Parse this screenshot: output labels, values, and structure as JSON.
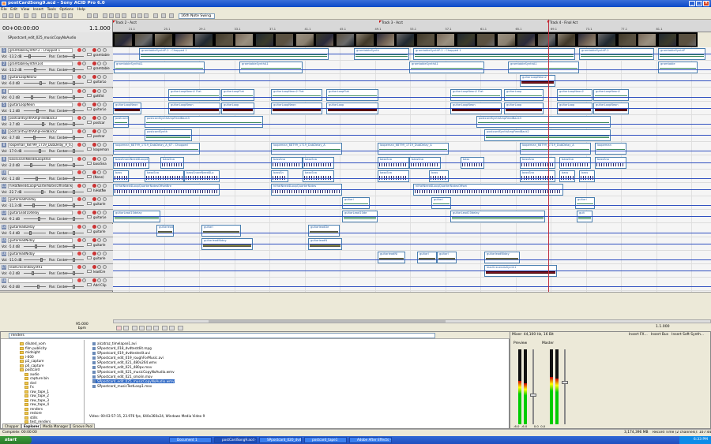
{
  "window": {
    "title": "postCardSong9.acd - Sony ACID Pro 6.0"
  },
  "menu": [
    "File",
    "Edit",
    "View",
    "Insert",
    "Tools",
    "Options",
    "Help"
  ],
  "toolbar": {
    "beat_mode": "16th Note Swing"
  },
  "time": {
    "position": "00+00:00:00",
    "tempo_scale": "1.1.000"
  },
  "markers": [
    {
      "label": "Track 2 - Acct",
      "pos": 0
    },
    {
      "label": "Track 3 - Acct",
      "pos": 0.45
    },
    {
      "label": "Track 4 - Final Act",
      "pos": 0.73
    }
  ],
  "ruler_ticks": [
    "21.1",
    "25.1",
    "29.1",
    "33.1",
    "37.1",
    "41.1",
    "45.1",
    "49.1",
    "53.1",
    "57.1",
    "61.1",
    "65.1",
    "69.1",
    "73.1",
    "77.1",
    "81.1"
  ],
  "video_track": {
    "name": "SPpostcard_edit_025_musicCopyNoAudio"
  },
  "tracks": [
    {
      "name": "gramtableSynthP-2 - Chopped 1",
      "vol": "Vol: -13.2 dB",
      "pan": "Pan: Center",
      "file": "gramtable"
    },
    {
      "name": "gramtableSynthA1x4",
      "vol": "Vol: -13.2 dB",
      "pan": "Pan: Center",
      "file": "gramtable"
    },
    {
      "name": "guitarLoopNeon2",
      "vol": "Vol: -6.0 dB",
      "pan": "Pan: Center",
      "file": "guitarLo"
    },
    {
      "name": "",
      "vol": "Vol: -0.2 dB",
      "pan": "Pan: Center",
      "file": "gattfat"
    },
    {
      "name": "guitarLoopNeon",
      "vol": "Vol: -1.1 dB",
      "pan": "Pan: Center",
      "file": "guitarLo"
    },
    {
      "name": "postcardSynthAmpFeedBack3",
      "vol": "Vol: -3.7 dB",
      "pan": "Pan: Center",
      "file": "postcar"
    },
    {
      "name": "postcardSynthAmpFeedBack2",
      "vol": "Vol: -3.7 dB",
      "pan": "Pan: Center",
      "file": "postcar"
    },
    {
      "name": "loopeman_68799_1719_DubDelay_A_67 - C",
      "vol": "Vol: -17.0 dB",
      "pan": "Pan: Center",
      "file": "loopeman"
    },
    {
      "name": "bassSnareNeed4Loop4fan",
      "vol": "Vol: -2.0 dB",
      "pan": "Pan: Center",
      "file": "bassSna"
    },
    {
      "name": "",
      "vol": "Vol: -1.1 dB",
      "pan": "Pan: Center",
      "file": "(None)"
    },
    {
      "name": "hiHatNeed4LoopPuarterNotesOffsetBrw",
      "vol": "Vol: -22.7 dB",
      "pan": "Pan: Center",
      "file": "hiHatNe"
    },
    {
      "name": "guitarleadhslday",
      "vol": "Vol: -11.3 dB",
      "pan": "Pan: Center",
      "file": "guitarle"
    },
    {
      "name": "guitarLead10delay",
      "vol": "Vol: -9.1 dB",
      "pan": "Pan: Center",
      "file": "guitarLe"
    },
    {
      "name": "guitarleadDelay",
      "vol": "Vol: -5.4 dB",
      "pan": "Pan: Center",
      "file": "guitarle"
    },
    {
      "name": "guitarleadNiday",
      "vol": "Vol: -5.4 dB",
      "pan": "Pan: Center",
      "file": "guitarle"
    },
    {
      "name": "guitarleadNiday",
      "vol": "Vol: -11.0 dB",
      "pan": "Pan: Center",
      "file": "guitarle"
    },
    {
      "name": "leadCrecendoSynth1",
      "vol": "Vol: -0.2 dB",
      "pan": "Pan: Center",
      "file": "leadCre"
    },
    {
      "name": "",
      "vol": "Vol: -6.0 dB",
      "pan": "Pan: Center",
      "file": "Add Clip"
    }
  ],
  "transport": {
    "bpm_value": "95.000",
    "bpm_label": "bpm",
    "position": "1.1.000"
  },
  "explorer": {
    "path": "renders",
    "tree": [
      "diluted_vom",
      "film publicity",
      "midnight",
      "i-600",
      "p2_capture",
      "p0_capture",
      "postcard",
      "audio",
      "capture bin",
      "dvd",
      "Fx",
      "raw_tape_1",
      "raw_tape_2",
      "raw_tape_3",
      "raw_tape_4",
      "renders",
      "restore",
      "stills",
      "test_renders"
    ],
    "files": [
      "alcatraz_timelapse1.avi",
      "SPpostcard_018_dvdtestdiit.mpg",
      "SPpostcard_019_dvdtestedit.avi",
      "SPpostcard_edit_019_roughForMusic.avi",
      "SPpostcard_edit_021_480x264.wmv",
      "SPpostcard_edit_021_480px.mov",
      "SPpostcard_edit_021_musicCopyNoAudio.wmv",
      "SPpostcard_edit_021_smolin.mov",
      "SPpostcard_edit_025_musicCopyNoAudio.wmv",
      "SPpostcard_musicTestLoop1.mov"
    ],
    "status": "Video: 00:03:57:15, 23.976 fps, 640x360x24, Windows Media Video 9",
    "tabs": [
      "Chopper",
      "Explorer",
      "Media Manager",
      "Groove Pool"
    ]
  },
  "mixer": {
    "title": "Mixer: 44,100 Hz, 16 Bit",
    "buttons": [
      "Insert FX...",
      "Insert Bus",
      "Insert Soft Synth..."
    ],
    "preview": "Preview",
    "master": "Master",
    "vals": [
      "-6.0",
      "-6.0",
      "0.0",
      "0.0"
    ]
  },
  "status": {
    "left": "Complete: 00:00:00",
    "mid": "3,174,396 MB",
    "right": "Record Time (2 channels): 107:44:13"
  },
  "taskbar": {
    "start": "start",
    "tasks": [
      "Document 1",
      "postCardSong9.acd - ...",
      "SPpostcard_020_dvd...",
      "postcard_tape1",
      "Adobe After Effects - ..."
    ],
    "clock": "6:33 PM"
  }
}
